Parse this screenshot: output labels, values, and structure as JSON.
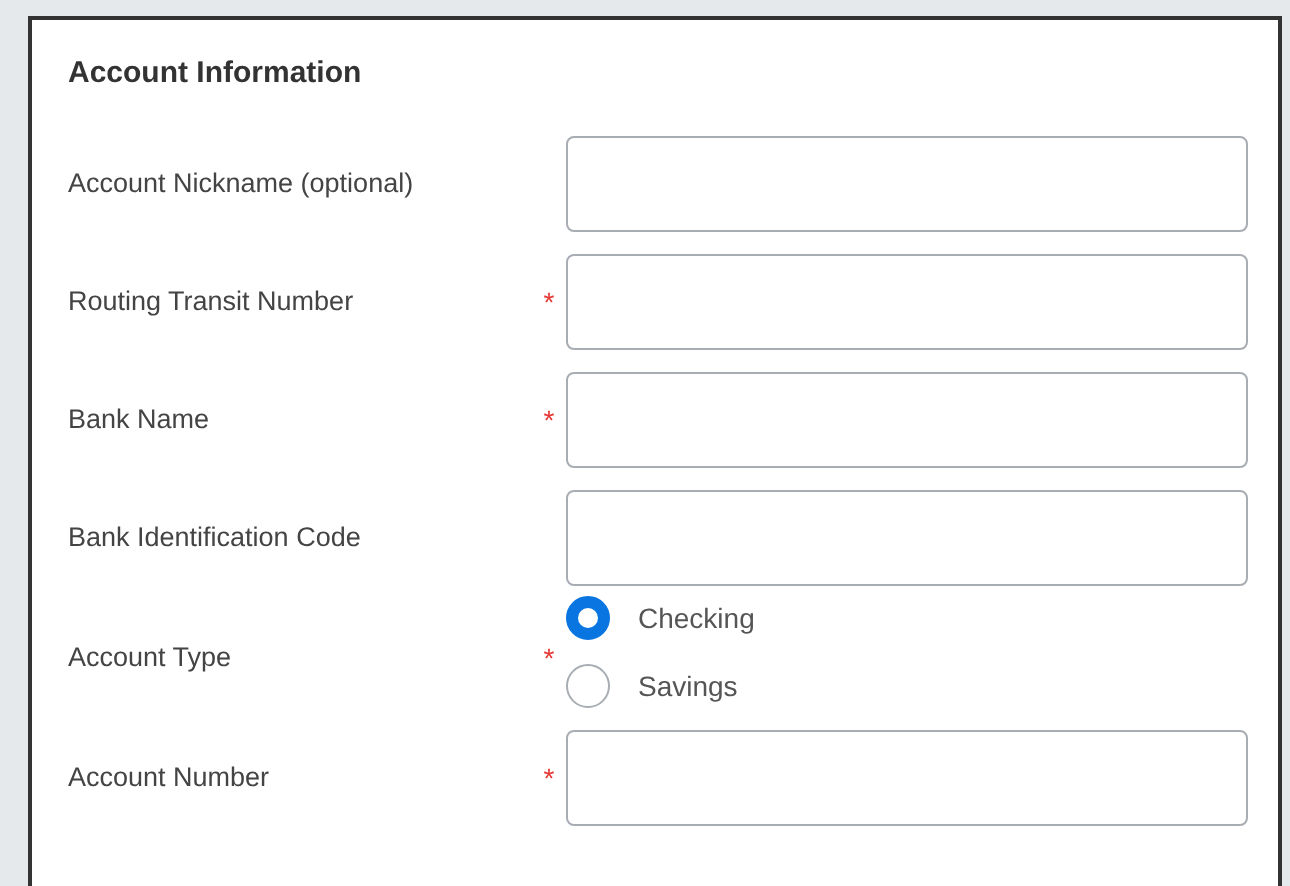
{
  "section": {
    "title": "Account Information"
  },
  "fields": [
    {
      "kind": "text",
      "label": "Account Nickname (optional)"
    },
    {
      "kind": "text",
      "label": "Routing Transit Number",
      "required_mark": "*"
    },
    {
      "kind": "text",
      "label": "Bank Name",
      "required_mark": "*"
    },
    {
      "kind": "text",
      "label": "Bank Identification Code"
    },
    {
      "kind": "radio",
      "label": "Account Type",
      "required_mark": "*",
      "options": [
        {
          "label": "Checking",
          "selected": true
        },
        {
          "label": "Savings",
          "selected": false
        }
      ]
    },
    {
      "kind": "text",
      "label": "Account Number",
      "required_mark": "*"
    }
  ]
}
